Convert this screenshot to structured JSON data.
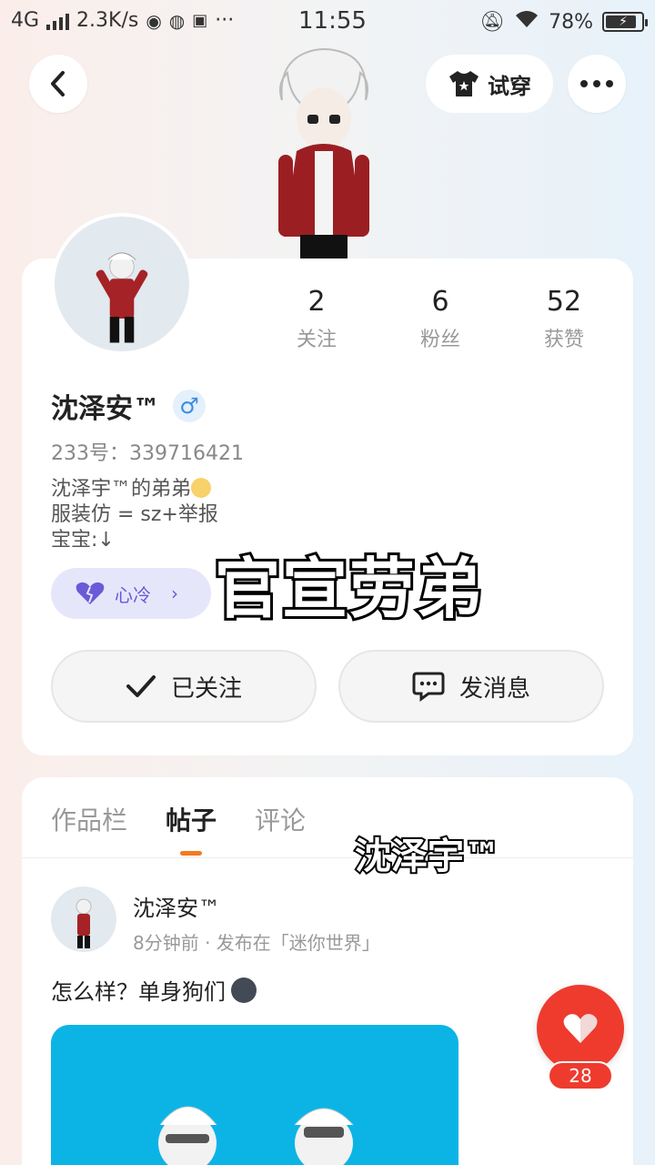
{
  "status_bar": {
    "network": "4G",
    "speed": "2.3K/s",
    "time": "11:55",
    "battery": "78%",
    "battery_level": 0.78
  },
  "top_nav": {
    "try_on_label": "试穿"
  },
  "profile": {
    "stats": [
      {
        "value": "2",
        "label": "关注"
      },
      {
        "value": "6",
        "label": "粉丝"
      },
      {
        "value": "52",
        "label": "获赞"
      }
    ],
    "name": "沈泽安™",
    "gender_symbol": "♂",
    "id_text": "233号：339716421",
    "bio_line1": "沈泽宇™的弟弟",
    "bio_line2": "服装仿 = sz+举报",
    "bio_line3": "宝宝:↓",
    "mood_label": "心冷",
    "follow_label": "已关注",
    "message_label": "发消息"
  },
  "overlays": {
    "big_caption": "官宣劳弟",
    "small_caption": "沈泽宇™"
  },
  "posts": {
    "tabs": [
      "作品栏",
      "帖子",
      "评论"
    ],
    "active_tab": "帖子",
    "post": {
      "author": "沈泽安™",
      "meta": "8分钟前 · 发布在「迷你世界」",
      "text": "怎么样？单身狗们"
    }
  },
  "like": {
    "count": "28"
  },
  "colors": {
    "accent_orange": "#f47a20",
    "like_red": "#ee3b2e",
    "mood_purple": "#6a5ad7",
    "post_image_blue": "#0cb4e6"
  }
}
